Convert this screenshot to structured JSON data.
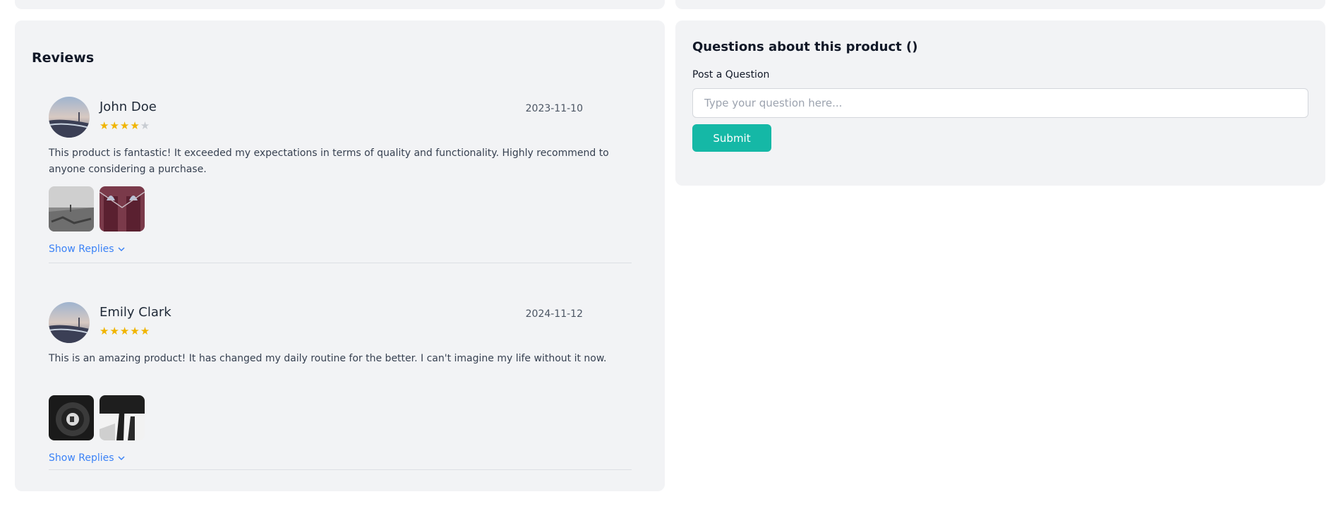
{
  "reviews": {
    "title": "Reviews",
    "items": [
      {
        "name": "John Doe",
        "date": "2023-11-10",
        "rating": 4,
        "stars": {
          "filled": "★★★★",
          "empty": "★"
        },
        "text": "This product is fantastic! It exceeded my expectations in terms of quality and functionality. Highly recommend to anyone considering a purchase.",
        "show_replies": "Show Replies"
      },
      {
        "name": "Emily Clark",
        "date": "2024-11-12",
        "rating": 5,
        "stars": {
          "filled": "★★★★★",
          "empty": ""
        },
        "text": "This is an amazing product! It has changed my daily routine for the better. I can't imagine my life without it now.",
        "show_replies": "Show Replies"
      }
    ]
  },
  "questions": {
    "title": "Questions about this product ()",
    "label": "Post a Question",
    "placeholder": "Type your question here...",
    "submit": "Submit"
  },
  "colors": {
    "accent": "#15b8a6",
    "link": "#3b82f6",
    "star": "#f0b400",
    "panel": "#f2f3f5"
  },
  "icons": [
    "chevron-down-icon"
  ]
}
